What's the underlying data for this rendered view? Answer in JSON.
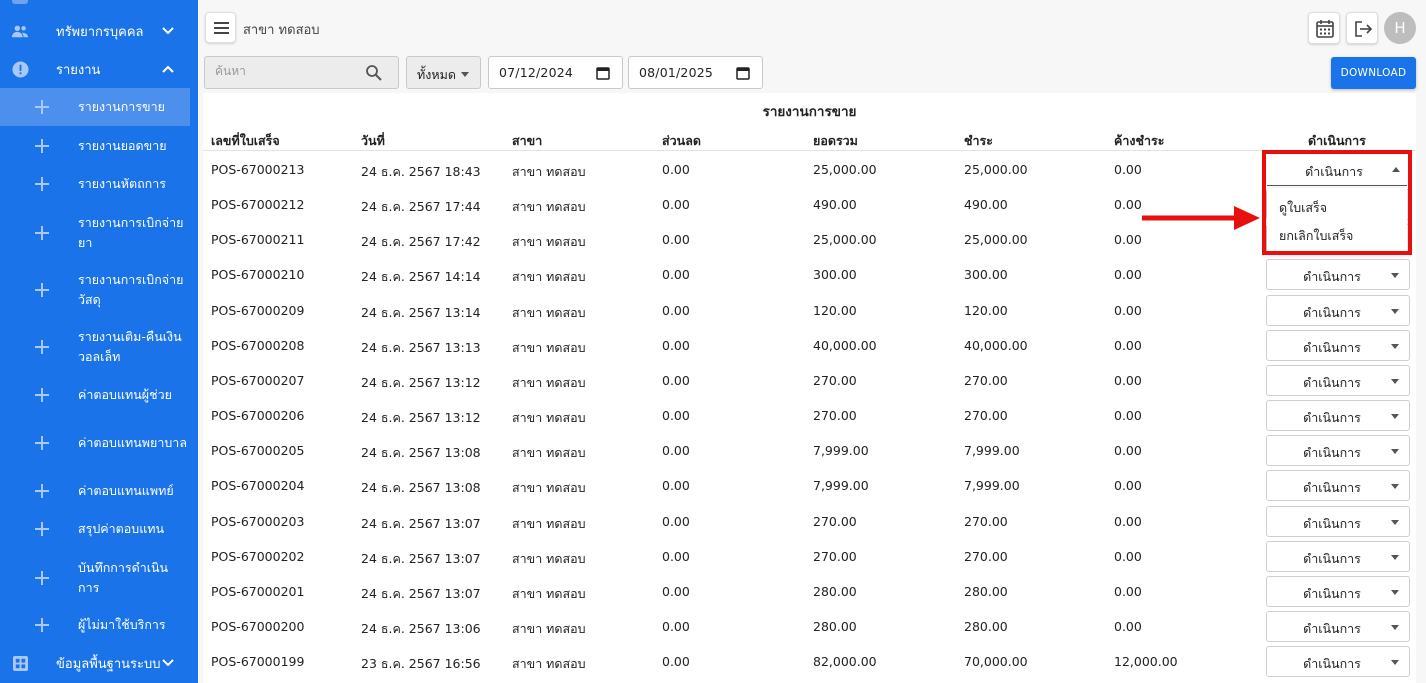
{
  "sidebar": {
    "groups": [
      {
        "label": "ทรัพยากรบุคคล",
        "icon": "people-icon"
      },
      {
        "label": "รายงาน",
        "icon": "alert-circle-icon"
      },
      {
        "label": "ข้อมูลพื้นฐานระบบ",
        "icon": "grid-icon"
      }
    ],
    "items": [
      {
        "label": "รายงานการขาย",
        "active": true
      },
      {
        "label": "รายงานยอดขาย"
      },
      {
        "label": "รายงานหัตถการ"
      },
      {
        "label": "รายงานการเบิกจ่ายยา"
      },
      {
        "label": "รายงานการเบิกจ่ายวัสดุ"
      },
      {
        "label": "รายงานเติม-คืนเงินวอลเล็ท"
      },
      {
        "label": "ค่าตอบแทนผู้ช่วย"
      },
      {
        "label": "ค่าตอบแทนพยาบาล"
      },
      {
        "label": "ค่าตอบแทนแพทย์"
      },
      {
        "label": "สรุปค่าตอบแทน"
      },
      {
        "label": "บันทึกการดำเนินการ"
      },
      {
        "label": "ผู้ไม่มาใช้บริการ"
      }
    ]
  },
  "header": {
    "branch_title": "สาขา ทดสอบ",
    "avatar_initial": "H"
  },
  "filters": {
    "search_placeholder": "ค้นหา",
    "status_select": "ทั้งหมด",
    "date_from": "07/12/2024",
    "date_to": "08/01/2025",
    "download_label": "DOWNLOAD"
  },
  "report": {
    "title": "รายงานการขาย",
    "columns": [
      "เลขที่ใบเสร็จ",
      "วันที่",
      "สาขา",
      "ส่วนลด",
      "ยอดรวม",
      "ชำระ",
      "ค้างชำระ",
      "ดำเนินการ"
    ],
    "action_label": "ดำเนินการ",
    "menu_options": [
      "ดูใบเสร็จ",
      "ยกเลิกใบเสร็จ"
    ],
    "rows": [
      [
        "POS-67000213",
        "24 ธ.ค. 2567 18:43",
        "สาขา ทดสอบ",
        "0.00",
        "25,000.00",
        "25,000.00",
        "0.00"
      ],
      [
        "POS-67000212",
        "24 ธ.ค. 2567 17:44",
        "สาขา ทดสอบ",
        "0.00",
        "490.00",
        "490.00",
        "0.00"
      ],
      [
        "POS-67000211",
        "24 ธ.ค. 2567 17:42",
        "สาขา ทดสอบ",
        "0.00",
        "25,000.00",
        "25,000.00",
        "0.00"
      ],
      [
        "POS-67000210",
        "24 ธ.ค. 2567 14:14",
        "สาขา ทดสอบ",
        "0.00",
        "300.00",
        "300.00",
        "0.00"
      ],
      [
        "POS-67000209",
        "24 ธ.ค. 2567 13:14",
        "สาขา ทดสอบ",
        "0.00",
        "120.00",
        "120.00",
        "0.00"
      ],
      [
        "POS-67000208",
        "24 ธ.ค. 2567 13:13",
        "สาขา ทดสอบ",
        "0.00",
        "40,000.00",
        "40,000.00",
        "0.00"
      ],
      [
        "POS-67000207",
        "24 ธ.ค. 2567 13:12",
        "สาขา ทดสอบ",
        "0.00",
        "270.00",
        "270.00",
        "0.00"
      ],
      [
        "POS-67000206",
        "24 ธ.ค. 2567 13:12",
        "สาขา ทดสอบ",
        "0.00",
        "270.00",
        "270.00",
        "0.00"
      ],
      [
        "POS-67000205",
        "24 ธ.ค. 2567 13:08",
        "สาขา ทดสอบ",
        "0.00",
        "7,999.00",
        "7,999.00",
        "0.00"
      ],
      [
        "POS-67000204",
        "24 ธ.ค. 2567 13:08",
        "สาขา ทดสอบ",
        "0.00",
        "7,999.00",
        "7,999.00",
        "0.00"
      ],
      [
        "POS-67000203",
        "24 ธ.ค. 2567 13:07",
        "สาขา ทดสอบ",
        "0.00",
        "270.00",
        "270.00",
        "0.00"
      ],
      [
        "POS-67000202",
        "24 ธ.ค. 2567 13:07",
        "สาขา ทดสอบ",
        "0.00",
        "270.00",
        "270.00",
        "0.00"
      ],
      [
        "POS-67000201",
        "24 ธ.ค. 2567 13:07",
        "สาขา ทดสอบ",
        "0.00",
        "280.00",
        "280.00",
        "0.00"
      ],
      [
        "POS-67000200",
        "24 ธ.ค. 2567 13:06",
        "สาขา ทดสอบ",
        "0.00",
        "280.00",
        "280.00",
        "0.00"
      ],
      [
        "POS-67000199",
        "23 ธ.ค. 2567 16:56",
        "สาขา ทดสอบ",
        "0.00",
        "82,000.00",
        "70,000.00",
        "12,000.00"
      ]
    ]
  },
  "colors": {
    "primary": "#1a73e8",
    "sidebar_active": "#4d8fed",
    "highlight": "#e8100f"
  }
}
